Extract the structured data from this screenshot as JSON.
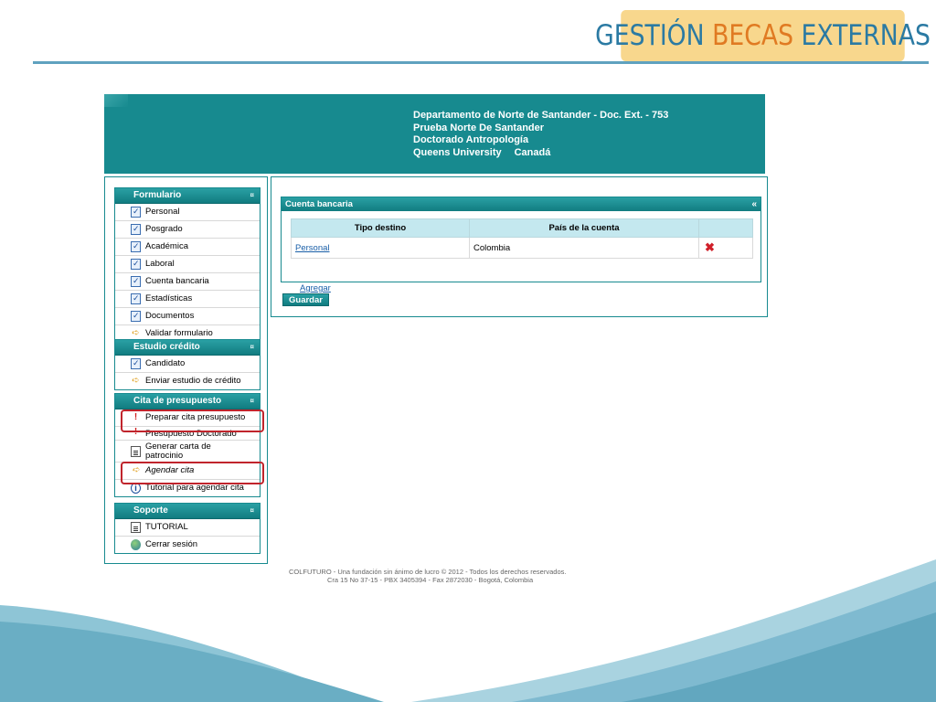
{
  "slide": {
    "title_part1": "GESTIÓN",
    "title_part2": "BECAS",
    "title_part3": "EXTERNAS",
    "colors": {
      "accent_blue": "#2b7aa3",
      "accent_orange": "#e07a22",
      "title_bg": "#f8d78d",
      "teal": "#178a8f"
    }
  },
  "header": {
    "line1": "Departamento de Norte de Santander - Doc. Ext. - 753",
    "line2": "Prueba Norte De Santander",
    "line3": "Doctorado Antropología",
    "university": "Queens University",
    "country": "Canadá"
  },
  "sidebar": {
    "formulario": {
      "title": "Formulario",
      "toggle": "¤",
      "items": [
        {
          "label": "Personal",
          "icon": "clipboard-check-icon"
        },
        {
          "label": "Posgrado",
          "icon": "clipboard-check-icon"
        },
        {
          "label": "Académica",
          "icon": "clipboard-check-icon"
        },
        {
          "label": "Laboral",
          "icon": "clipboard-check-icon"
        },
        {
          "label": "Cuenta bancaria",
          "icon": "clipboard-check-icon"
        },
        {
          "label": "Estadísticas",
          "icon": "clipboard-check-icon"
        },
        {
          "label": "Documentos",
          "icon": "clipboard-check-icon"
        },
        {
          "label": "Validar formulario",
          "icon": "arrow-icon"
        }
      ]
    },
    "estudio": {
      "title": "Estudio crédito",
      "toggle": "¤",
      "items": [
        {
          "label": "Candidato",
          "icon": "clipboard-check-icon"
        },
        {
          "label": "Enviar estudio de crédito",
          "icon": "arrow-icon"
        }
      ]
    },
    "cita": {
      "title": "Cita de presupuesto",
      "toggle": "¤",
      "items": [
        {
          "label": "Preparar cita presupuesto",
          "icon": "exclamation-icon"
        },
        {
          "label": "Presupuesto Doctorado",
          "icon": "exclamation-icon"
        },
        {
          "label": "Generar carta de patrocinio",
          "icon": "document-icon"
        },
        {
          "label": "Agendar cita",
          "icon": "arrow-icon"
        },
        {
          "label": "Tutorial para agendar cita",
          "icon": "info-icon"
        }
      ]
    },
    "soporte": {
      "title": "Soporte",
      "toggle": "¤",
      "items": [
        {
          "label": "TUTORIAL",
          "icon": "document-icon"
        },
        {
          "label": "Cerrar sesión",
          "icon": "globe-icon"
        }
      ]
    }
  },
  "panel": {
    "title": "Cuenta bancaria",
    "collapse": "«",
    "columns": [
      "Tipo destino",
      "País de la cuenta",
      ""
    ],
    "rows": [
      {
        "tipo": "Personal",
        "pais": "Colombia",
        "action": "delete-icon"
      }
    ],
    "agregar": "Agregar",
    "guardar": "Guardar"
  },
  "footer": {
    "line1": "COLFUTURO - Una fundación sin ánimo de lucro © 2012 - Todos los derechos reservados.",
    "line2": "Cra 15 No 37-15 - PBX 3405394 - Fax 2872030 - Bogotá, Colombia"
  }
}
